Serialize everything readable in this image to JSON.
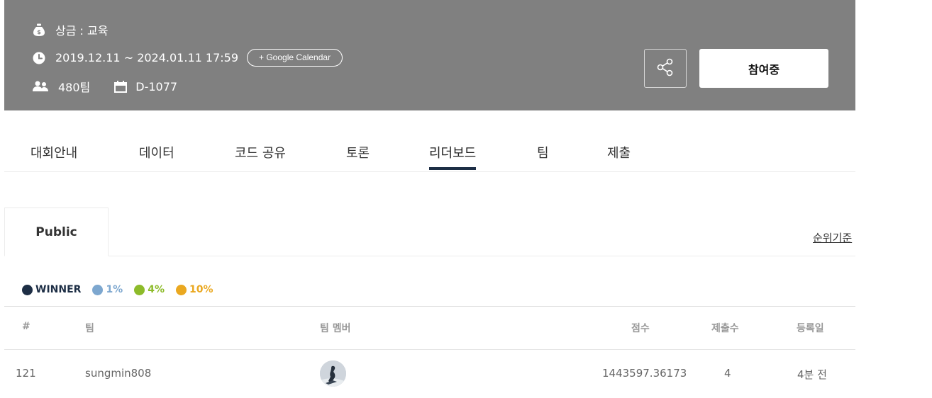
{
  "header": {
    "prize_text": "상금 : 교육",
    "date_range": "2019.12.11 ~ 2024.01.11 17:59",
    "gcal_label": "+ Google Calendar",
    "teams_count": "480팀",
    "dday": "D-1077",
    "join_label": "참여중",
    "icons": [
      "money-bag-icon",
      "clock-icon",
      "people-icon",
      "calendar-icon",
      "share-icon"
    ]
  },
  "tabs": [
    "대회안내",
    "데이터",
    "코드 공유",
    "토론",
    "리더보드",
    "팀",
    "제출"
  ],
  "active_tab": "리더보드",
  "subtab": {
    "label": "Public",
    "rank_criteria": "순위기준"
  },
  "legend": [
    {
      "label": "WINNER",
      "color": "#1d2e45"
    },
    {
      "label": "1%",
      "color": "#7da7cf"
    },
    {
      "label": "4%",
      "color": "#8dbb2a"
    },
    {
      "label": "10%",
      "color": "#eaa820"
    }
  ],
  "table": {
    "headers": [
      "#",
      "팀",
      "팀 멤버",
      "점수",
      "제출수",
      "등록일"
    ],
    "rows": [
      {
        "rank": "121",
        "team": "sungmin808",
        "score": "1443597.36173",
        "submissions": "4",
        "registered": "4분 전"
      }
    ]
  }
}
